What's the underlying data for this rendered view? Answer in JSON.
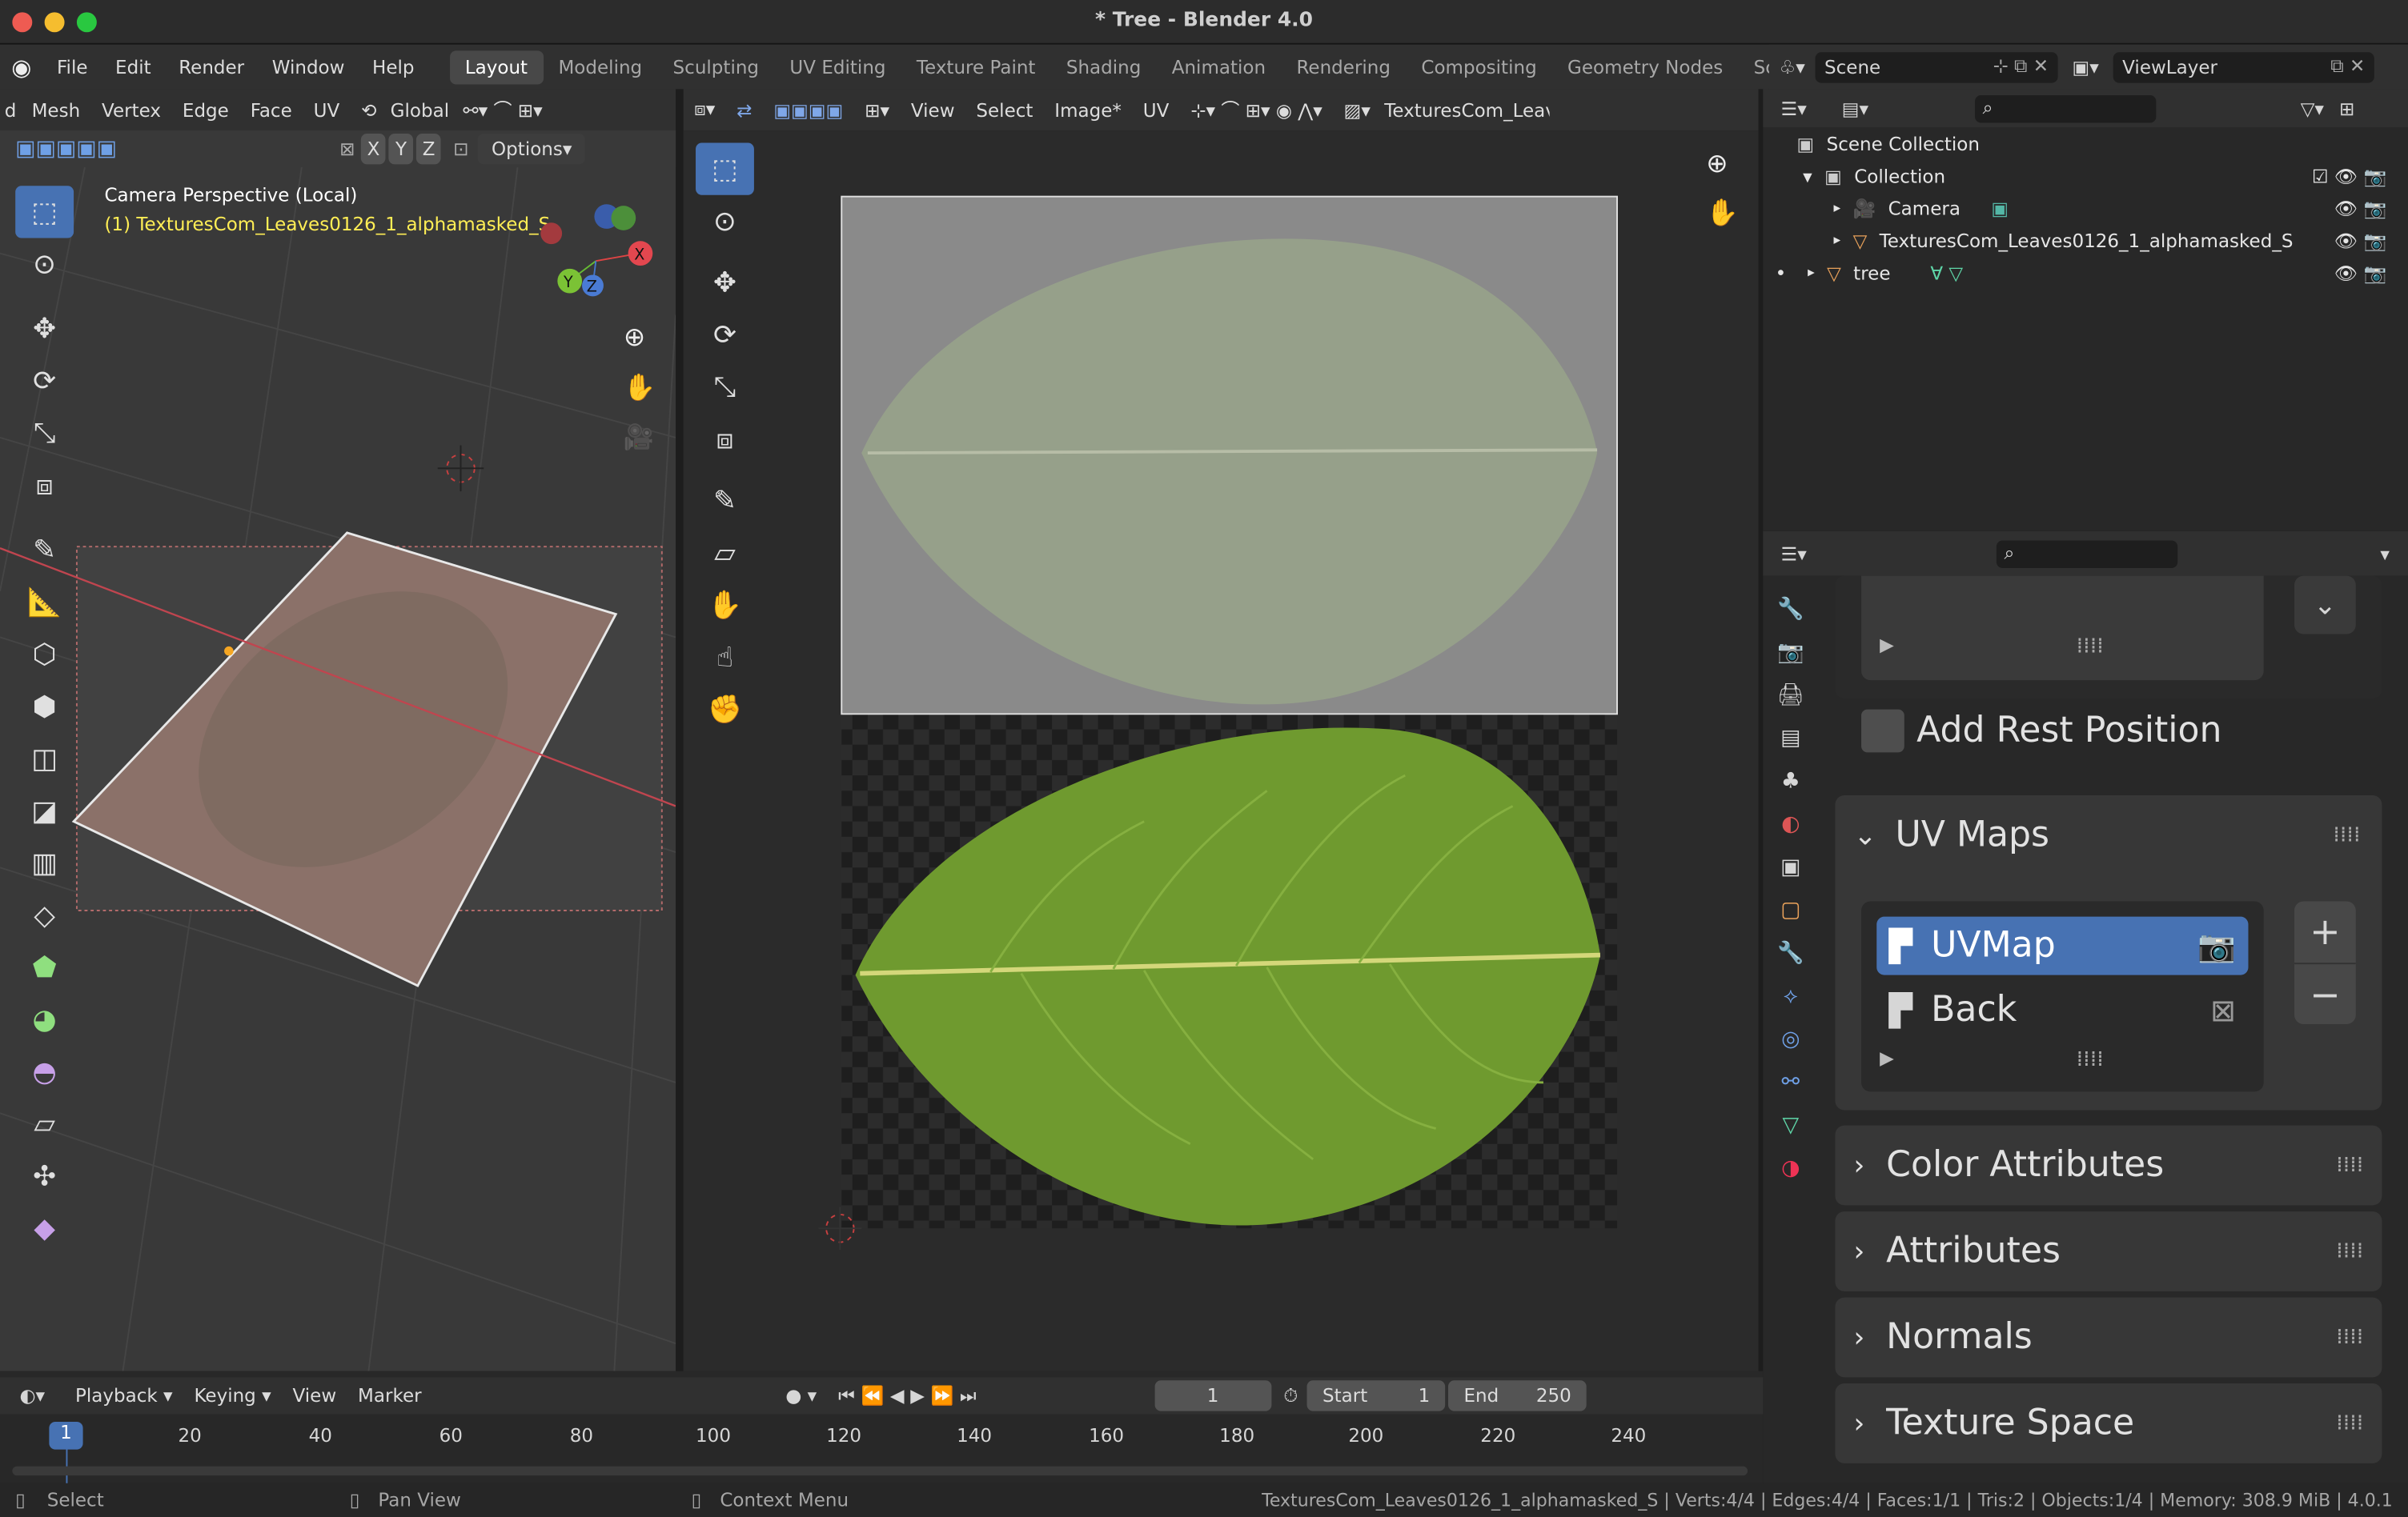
{
  "window": {
    "title": "* Tree - Blender 4.0"
  },
  "menu": [
    "File",
    "Edit",
    "Render",
    "Window",
    "Help"
  ],
  "workspaces": [
    "Layout",
    "Modeling",
    "Sculpting",
    "UV Editing",
    "Texture Paint",
    "Shading",
    "Animation",
    "Rendering",
    "Compositing",
    "Geometry Nodes",
    "Scripting"
  ],
  "scene": {
    "name": "Scene",
    "view_layer": "ViewLayer"
  },
  "viewport3d": {
    "menus": [
      "d",
      "Mesh",
      "Vertex",
      "Edge",
      "Face",
      "UV"
    ],
    "orientation": "Global",
    "options_label": "Options",
    "axes": [
      "X",
      "Y",
      "Z"
    ],
    "overlay_title": "Camera Perspective (Local)",
    "overlay_object": "(1) TexturesCom_Leaves0126_1_alphamasked_S",
    "gizmo_labels": [
      "X",
      "Y",
      "Z"
    ]
  },
  "uv_editor": {
    "menus": [
      "View",
      "Select",
      "Image*",
      "UV"
    ],
    "image_name": "TexturesCom_Leav"
  },
  "outliner": {
    "root": "Scene Collection",
    "collection": "Collection",
    "items": [
      {
        "name": "Camera",
        "icon": "camera-icon"
      },
      {
        "name": "TexturesCom_Leaves0126_1_alphamasked_S",
        "icon": "mesh-icon"
      },
      {
        "name": "tree",
        "icon": "mesh-icon"
      }
    ]
  },
  "properties": {
    "add_rest_position": "Add Rest Position",
    "uv_maps_title": "UV Maps",
    "uv_maps": [
      {
        "name": "UVMap",
        "active": true
      },
      {
        "name": "Back",
        "active": false
      }
    ],
    "sections": [
      "Color Attributes",
      "Attributes",
      "Normals",
      "Texture Space"
    ]
  },
  "timeline": {
    "menus": [
      "Playback",
      "Keying",
      "View",
      "Marker"
    ],
    "current_frame": "1",
    "start_label": "Start",
    "start": "1",
    "end_label": "End",
    "end": "250",
    "ruler": [
      "1",
      "20",
      "40",
      "60",
      "80",
      "100",
      "120",
      "140",
      "160",
      "180",
      "200",
      "220",
      "240"
    ]
  },
  "statusbar": {
    "select": "Select",
    "pan": "Pan View",
    "context": "Context Menu",
    "info": "TexturesCom_Leaves0126_1_alphamasked_S | Verts:4/4 | Edges:4/4 | Faces:1/1 | Tris:2 | Objects:1/4 | Memory: 308.9 MiB | 4.0.1"
  },
  "colors": {
    "accent": "#4772b3",
    "selected_text": "#ffff8a",
    "leaf": "#6f9a2f"
  }
}
